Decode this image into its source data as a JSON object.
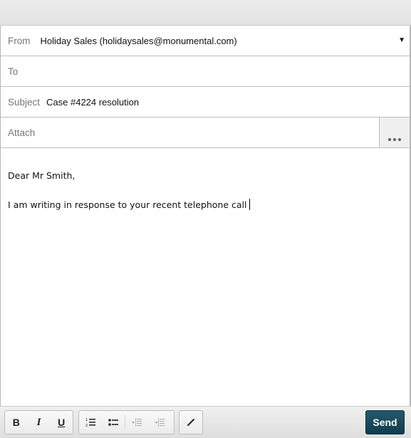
{
  "compose": {
    "from": {
      "label": "From",
      "value": "Holiday Sales (holidaysales@monumental.com)"
    },
    "to": {
      "label": "To",
      "value": ""
    },
    "subject": {
      "label": "Subject",
      "value": "Case #4224 resolution"
    },
    "attach": {
      "label": "Attach",
      "button_icon": "more-icon"
    }
  },
  "body": {
    "lines": [
      "Dear Mr Smith,",
      "I am writing in response to your recent telephone call"
    ]
  },
  "toolbar": {
    "bold": "B",
    "italic": "I",
    "underline": "U",
    "send_label": "Send"
  },
  "colors": {
    "send_button": "#1a4a5c"
  }
}
